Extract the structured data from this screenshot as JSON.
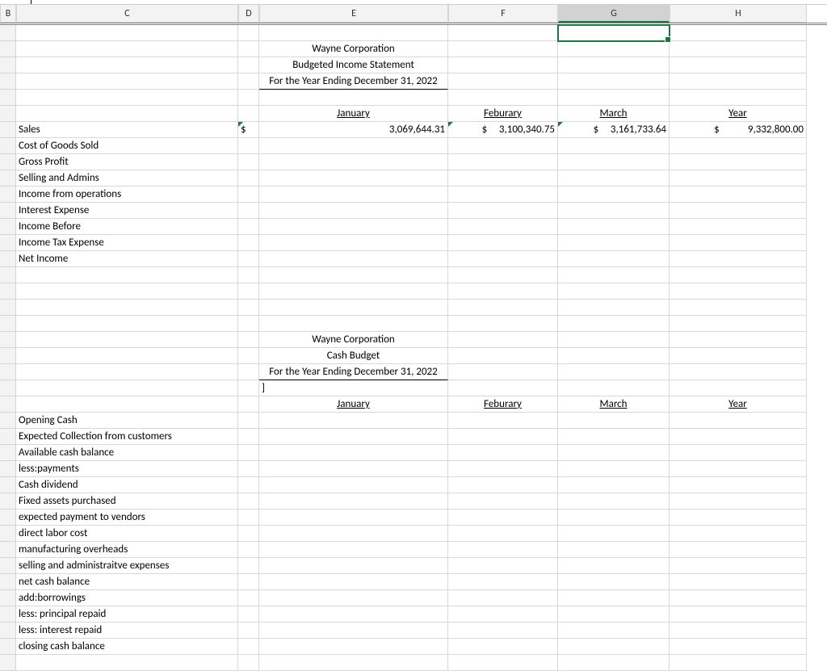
{
  "columns": [
    "B",
    "C",
    "D",
    "E",
    "F",
    "G",
    "H"
  ],
  "selected_col_index": 5,
  "title1": {
    "company": "Wayne Corporation",
    "report": "Budgeted Income Statement",
    "period": "For the Year Ending December 31, 2022"
  },
  "months": {
    "jan": "January",
    "feb": "Feburary",
    "mar": "March",
    "year": "Year"
  },
  "dollar": "$",
  "sales": {
    "label": "Sales",
    "jan": "3,069,644.31",
    "feb": "3,100,340.75",
    "mar": "3,161,733.64",
    "year": "9,332,800.00"
  },
  "income_rows": [
    "Cost of Goods Sold",
    "Gross Profit",
    "Selling and Admins",
    "Income from operations",
    "Interest Expense",
    "Income Before",
    "Income Tax Expense",
    "Net Income"
  ],
  "title2": {
    "company": "Wayne Corporation",
    "report": "Cash Budget",
    "period": "For the Year Ending December 31, 2022"
  },
  "stray": "]",
  "cash_rows": [
    "Opening Cash",
    "Expected Collection from customers",
    "Available cash balance",
    "less:payments",
    "Cash dividend",
    "Fixed assets purchased",
    "expected payment  to vendors",
    "direct labor cost",
    "manufacturing overheads",
    "selling and administraitve expenses",
    "net cash balance",
    "add:borrowings",
    "less: principal repaid",
    "less: interest repaid",
    "closing cash balance"
  ]
}
